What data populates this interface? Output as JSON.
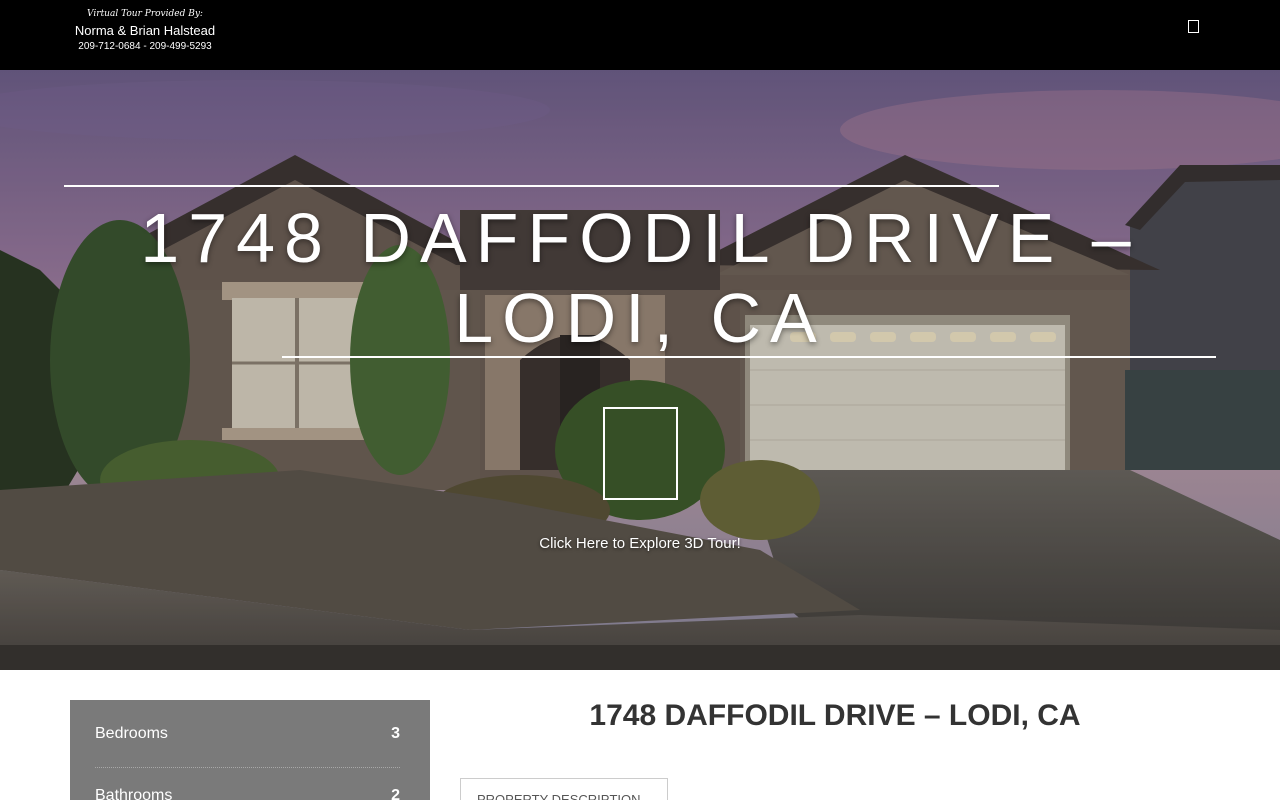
{
  "header": {
    "tagline": "Virtual Tour Provided By:",
    "agent_name": "Norma & Brian Halstead",
    "phones": "209-712-0684 - 209-499-5293",
    "menu_icon": "menu-icon"
  },
  "hero": {
    "title": "1748 DAFFODIL DRIVE – LODI, CA",
    "tour_cta": "Click Here to Explore 3D Tour!",
    "tour_icon": "play-icon"
  },
  "stats": {
    "bedrooms_label": "Bedrooms",
    "bedrooms_value": "3",
    "bathrooms_label": "Bathrooms",
    "bathrooms_value": "2"
  },
  "content": {
    "title": "1748 DAFFODIL DRIVE – LODI, CA",
    "description_tab": "PROPERTY DESCRIPTION"
  }
}
